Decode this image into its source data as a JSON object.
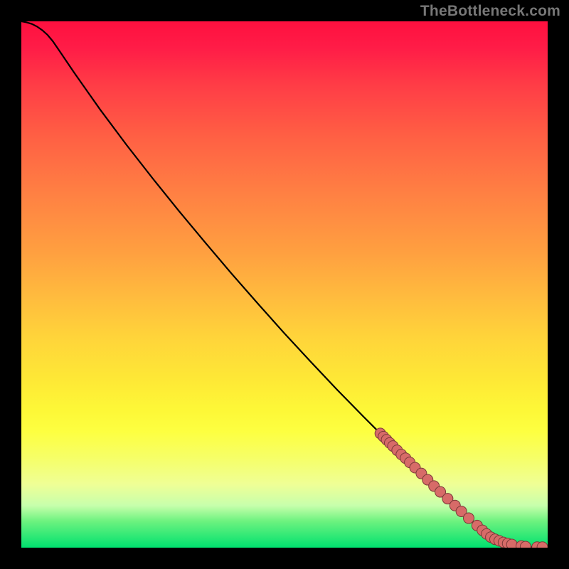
{
  "watermark": {
    "text": "TheBottleneck.com"
  },
  "colors": {
    "bg_black": "#000000",
    "curve": "#000000",
    "point_fill": "#d76b68",
    "point_stroke": "#7a3a38",
    "watermark": "#777777"
  },
  "chart_data": {
    "type": "line",
    "title": "",
    "xlabel": "",
    "ylabel": "",
    "xlim": [
      0,
      100
    ],
    "ylim": [
      0,
      100
    ],
    "curve": {
      "x": [
        0,
        1,
        2,
        3,
        4,
        5,
        6,
        7.5,
        10,
        15,
        20,
        25,
        30,
        35,
        40,
        45,
        50,
        55,
        60,
        65,
        68,
        72,
        75,
        78,
        80,
        82,
        84,
        85,
        86.5,
        88,
        90,
        92,
        94,
        96,
        98,
        100
      ],
      "y": [
        100,
        99.8,
        99.5,
        99.0,
        98.3,
        97.4,
        96.2,
        94.0,
        90.3,
        83.2,
        76.5,
        70.1,
        63.9,
        57.9,
        52.0,
        46.3,
        40.7,
        35.3,
        30.0,
        24.9,
        21.9,
        18.0,
        15.1,
        12.2,
        10.3,
        8.4,
        6.5,
        5.6,
        4.3,
        3.0,
        1.7,
        0.8,
        0.3,
        0.15,
        0.1,
        0.1
      ]
    },
    "points_on_curve": {
      "x": [
        68.2,
        68.8,
        69.4,
        70.0,
        70.6,
        71.4,
        72.2,
        73.0,
        73.8,
        74.8,
        76.0,
        77.2,
        78.4,
        79.6,
        81.0,
        82.4,
        83.6,
        85.0,
        86.6,
        87.6,
        88.4,
        89.2,
        90.0,
        90.8,
        91.6,
        92.4,
        93.2,
        95.0,
        95.8,
        98.0,
        99.0
      ],
      "y": [
        21.7,
        21.1,
        20.5,
        19.9,
        19.3,
        18.5,
        17.7,
        17.0,
        16.2,
        15.2,
        14.1,
        12.9,
        11.7,
        10.6,
        9.3,
        8.0,
        6.9,
        5.6,
        4.2,
        3.3,
        2.6,
        2.0,
        1.6,
        1.3,
        1.0,
        0.8,
        0.6,
        0.3,
        0.2,
        0.1,
        0.1
      ]
    }
  }
}
